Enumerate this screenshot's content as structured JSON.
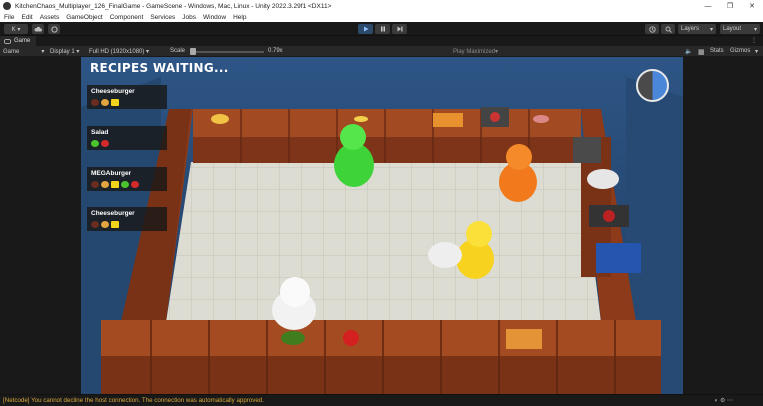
{
  "window": {
    "title": "KitchenChaos_Multiplayer_126_FinalGame - GameScene - Windows, Mac, Linux - Unity 2022.3.29f1 <DX11>",
    "min_glyph": "—",
    "max_glyph": "❐",
    "close_glyph": "✕"
  },
  "menu": [
    "File",
    "Edit",
    "Assets",
    "GameObject",
    "Component",
    "Services",
    "Jobs",
    "Window",
    "Help"
  ],
  "toolbar": {
    "account_label": "K ▾",
    "layers_label": "Layers",
    "layout_label": "Layout"
  },
  "tab": {
    "label": "Game"
  },
  "game_bar": {
    "mode": "Game",
    "display": "Display 1",
    "resolution": "Full HD (1920x1080)",
    "scale_label": "Scale",
    "scale_value": "0.79x",
    "play_mode": "Play Maximized",
    "stats": "Stats",
    "gizmos": "Gizmos"
  },
  "hud": {
    "title": "RECIPES WAITING...",
    "recipes": [
      {
        "name": "Cheeseburger",
        "ingredients": [
          "meat",
          "bread",
          "cheese"
        ]
      },
      {
        "name": "Salad",
        "ingredients": [
          "lettuce",
          "tomato"
        ]
      },
      {
        "name": "MEGAburger",
        "ingredients": [
          "meat",
          "bread",
          "cheese",
          "lettuce",
          "tomato"
        ]
      },
      {
        "name": "Cheeseburger",
        "ingredients": [
          "meat",
          "bread",
          "cheese"
        ]
      }
    ],
    "timer_fill_fraction": 0.5,
    "timer_color": "#4b87d8"
  },
  "status": {
    "message": "[Netcode] You cannot decline the host connection. The connection was automatically approved."
  },
  "colors": {
    "accent_play": "#8fc1ff",
    "warning_text": "#d9a93b",
    "counter_wood": "#8a3a1c",
    "floor_tile": "#dcdcd2",
    "wall_blue": "#2a4f7a",
    "player_green": "#3fd33a",
    "player_orange": "#f27a1c",
    "player_yellow": "#f7d21e",
    "player_white": "#f2f2f2"
  }
}
